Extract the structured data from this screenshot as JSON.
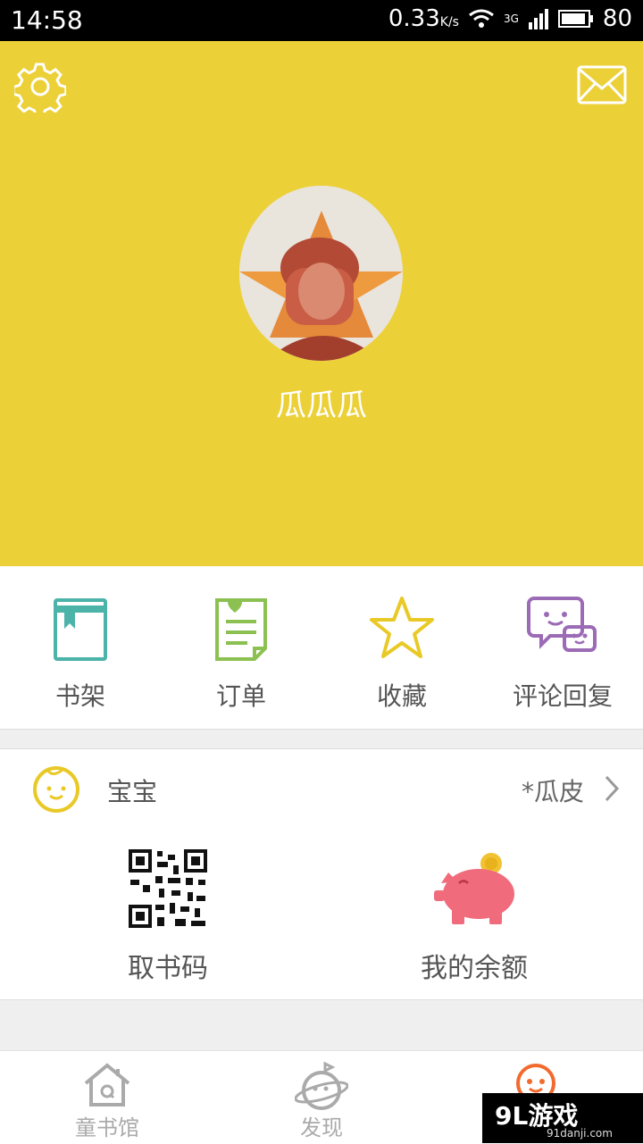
{
  "status_bar": {
    "time": "14:58",
    "speed": "0.33",
    "speed_unit": "K/s",
    "network": "3G",
    "battery": "80"
  },
  "profile": {
    "username": "瓜瓜瓜"
  },
  "quick_actions": [
    {
      "label": "书架",
      "icon": "bookshelf-icon",
      "color": "#4bb3a8"
    },
    {
      "label": "订单",
      "icon": "order-icon",
      "color": "#8cc152"
    },
    {
      "label": "收藏",
      "icon": "star-icon",
      "color": "#e9c926"
    },
    {
      "label": "评论回复",
      "icon": "comment-icon",
      "color": "#9b6bb6"
    }
  ],
  "baby": {
    "label": "宝宝",
    "value": "*瓜皮"
  },
  "tools": [
    {
      "label": "取书码",
      "icon": "qr-code-icon"
    },
    {
      "label": "我的余额",
      "icon": "piggy-bank-icon",
      "color": "#f06b7c"
    }
  ],
  "tabs": [
    {
      "label": "童书馆",
      "icon": "home-icon"
    },
    {
      "label": "发现",
      "icon": "planet-icon"
    },
    {
      "label": "",
      "icon": "smiley-icon",
      "active": true,
      "color": "#f26a2e"
    }
  ],
  "watermark": {
    "brand": "9L游戏",
    "site": "91danji.com"
  },
  "colors": {
    "header": "#ecd038",
    "accent": "#f26a2e"
  }
}
